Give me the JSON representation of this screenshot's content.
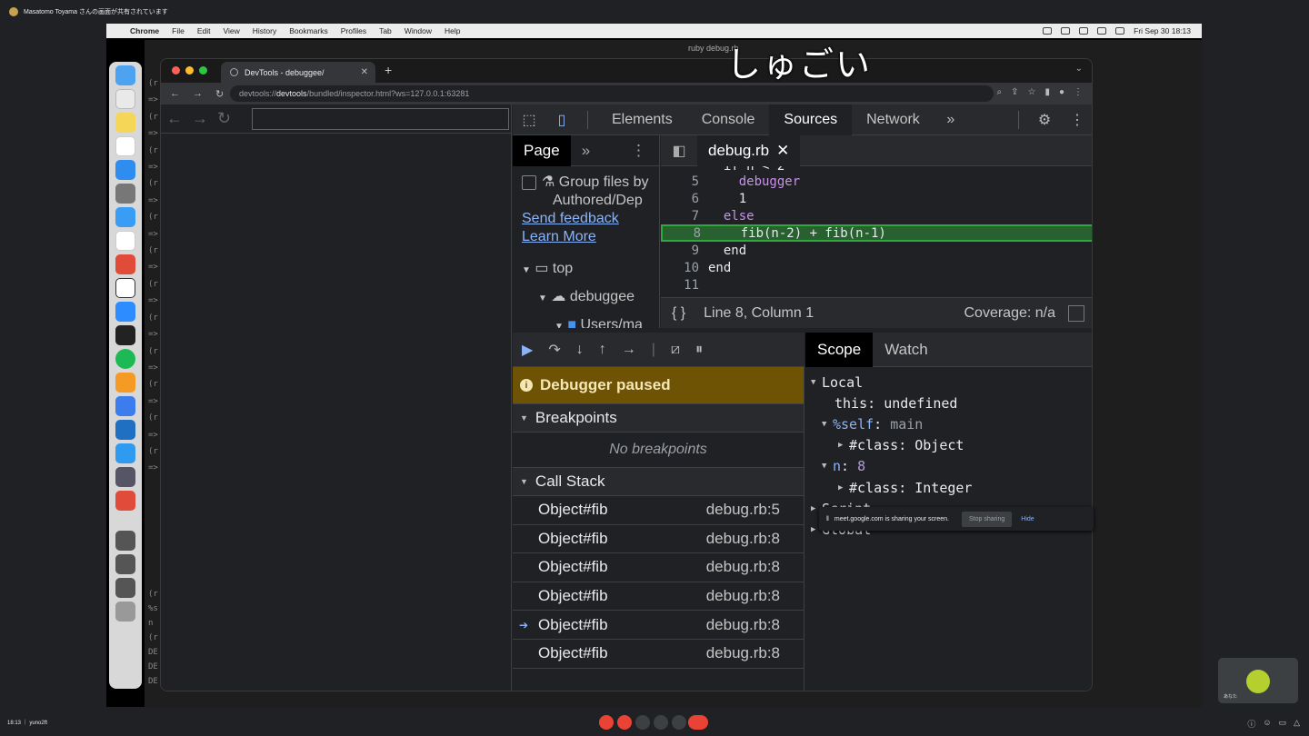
{
  "meet": {
    "top_title": "Masatomo Toyama さんの画面が共有されています",
    "bottom_left": "18:13 ｜ yuno2ft",
    "share_toast": "meet.google.com is sharing your screen.",
    "stop_sharing": "Stop sharing",
    "hide": "Hide",
    "self_label": "あなた"
  },
  "mac": {
    "menu": [
      "Chrome",
      "File",
      "Edit",
      "View",
      "History",
      "Bookmarks",
      "Profiles",
      "Tab",
      "Window",
      "Help"
    ],
    "datetime": "Fri Sep 30  18:13",
    "window_title": "ruby debug.rb"
  },
  "overlay_title": "しゅごい",
  "terminal": {
    "prompt_fragment": "(r",
    "frag2": "=>",
    "frag3": "%s",
    "frag4": "n",
    "frag5": "DE"
  },
  "chrome": {
    "tab_title": "DevTools - debuggee/",
    "new_tab": "+",
    "url_prefix": "devtools://",
    "url_host": "devtools",
    "url_rest": "/bundled/inspector.html?ws=127.0.0.1:63281"
  },
  "devtools": {
    "tabs": [
      "Elements",
      "Console",
      "Sources",
      "Network"
    ],
    "active_tab": "Sources",
    "more": "»",
    "navigator": {
      "tab": "Page",
      "group_files_1": "Group files by",
      "group_files_2": "Authored/Dep",
      "send_feedback": "Send feedback",
      "learn_more": "Learn More",
      "tree_top": "top",
      "tree_debuggee": "debuggee",
      "tree_users": "Users/ma"
    },
    "editor_tab": "debug.rb",
    "code_lines": [
      {
        "n": "5",
        "text": "    debugger"
      },
      {
        "n": "6",
        "text": "    1"
      },
      {
        "n": "7",
        "text": "  else"
      },
      {
        "n": "8",
        "text": "    fib(n-2) + fib(n-1)"
      },
      {
        "n": "9",
        "text": "  end"
      },
      {
        "n": "10",
        "text": "end"
      },
      {
        "n": "11",
        "text": ""
      }
    ],
    "status_position": "Line 8, Column 1",
    "coverage": "Coverage: n/a",
    "paused": "Debugger paused",
    "breakpoints_header": "Breakpoints",
    "no_breakpoints": "No breakpoints",
    "call_stack_header": "Call Stack",
    "call_stack": [
      {
        "fn": "Object#fib",
        "loc": "debug.rb:5"
      },
      {
        "fn": "Object#fib",
        "loc": "debug.rb:8"
      },
      {
        "fn": "Object#fib",
        "loc": "debug.rb:8"
      },
      {
        "fn": "Object#fib",
        "loc": "debug.rb:8"
      },
      {
        "fn": "Object#fib",
        "loc": "debug.rb:8"
      },
      {
        "fn": "Object#fib",
        "loc": "debug.rb:8"
      }
    ],
    "scope_tab": "Scope",
    "watch_tab": "Watch",
    "scope": {
      "local": "Local",
      "this_key": "this",
      "this_val": "undefined",
      "self_key": "%self",
      "self_val": "main",
      "class_key": "#class",
      "class_val1": "Object",
      "n_key": "n",
      "n_val": "8",
      "class_val2": "Integer",
      "script": "Script",
      "global": "Global"
    }
  }
}
